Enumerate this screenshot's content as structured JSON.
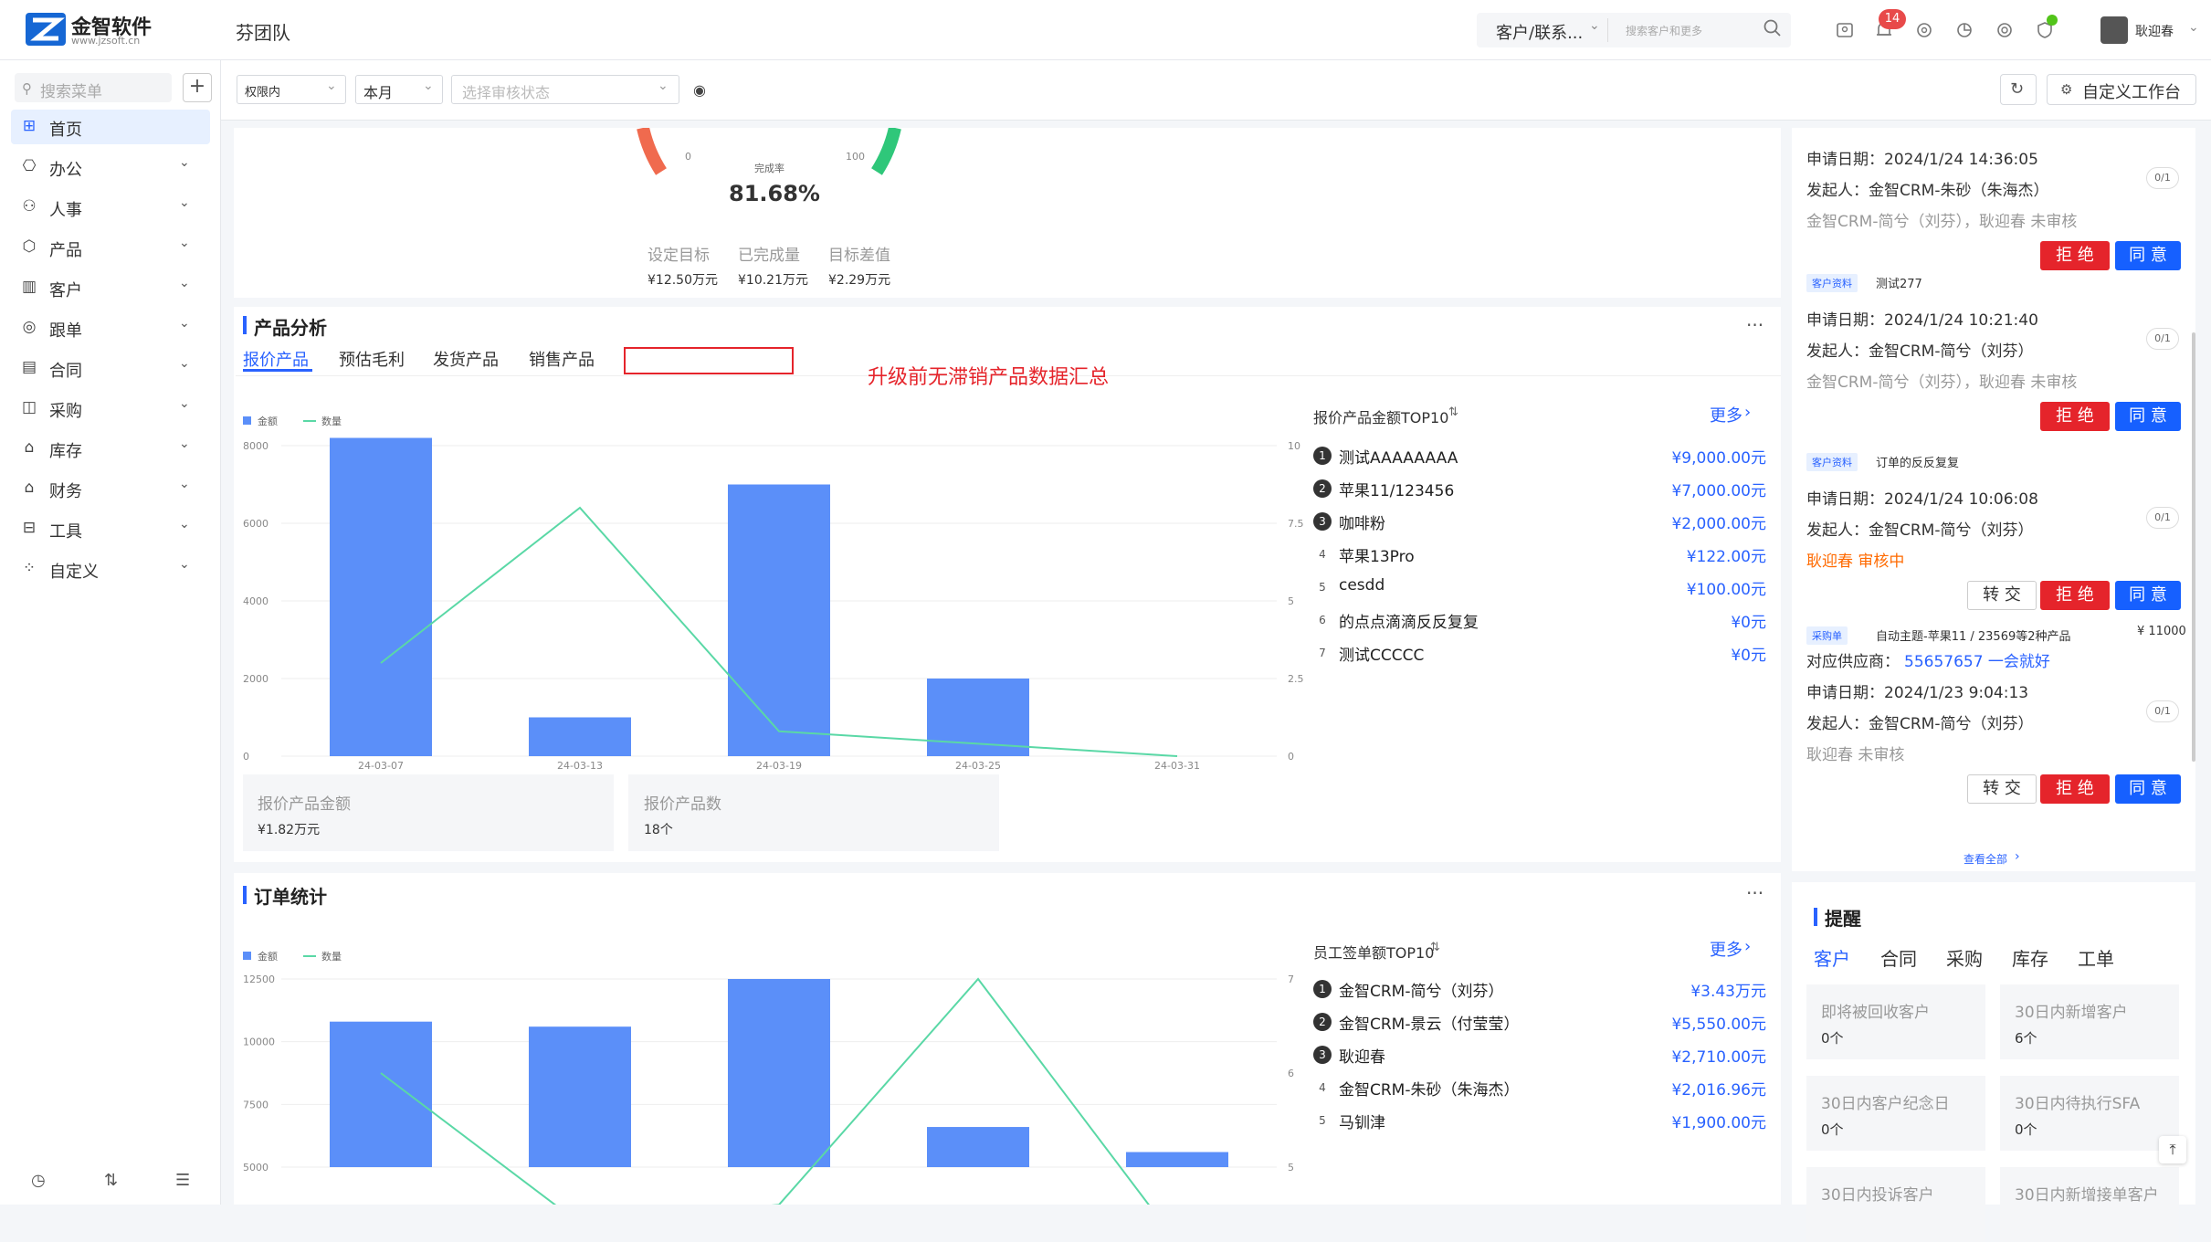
{
  "brand": {
    "name": "金智软件",
    "site": "www.jzsoft.cn"
  },
  "header": {
    "team": "芬团队",
    "search_type": "客户/联系...",
    "search_placeholder": "搜索客户和更多",
    "notification_count": "14",
    "username": "耿迎春"
  },
  "sidebar": {
    "search_placeholder": "搜索菜单",
    "items": [
      {
        "label": "首页",
        "icon": "home-icon"
      },
      {
        "label": "办公",
        "icon": "office-icon"
      },
      {
        "label": "人事",
        "icon": "person-icon"
      },
      {
        "label": "产品",
        "icon": "cube-icon"
      },
      {
        "label": "客户",
        "icon": "chart-icon"
      },
      {
        "label": "跟单",
        "icon": "target-icon"
      },
      {
        "label": "合同",
        "icon": "document-icon"
      },
      {
        "label": "采购",
        "icon": "bag-icon"
      },
      {
        "label": "库存",
        "icon": "warehouse-icon"
      },
      {
        "label": "财务",
        "icon": "money-icon"
      },
      {
        "label": "工具",
        "icon": "toolbox-icon"
      },
      {
        "label": "自定义",
        "icon": "grid-icon"
      }
    ]
  },
  "filters": {
    "scope": "权限内",
    "period": "本月",
    "status_placeholder": "选择审核状态",
    "custom_workbench": "自定义工作台"
  },
  "gauge": {
    "min_label": "0",
    "max_label": "100",
    "caption": "完成率",
    "percent": "81.68%",
    "value": 81.68,
    "stats": [
      {
        "label": "设定目标",
        "value": "¥12.50万元"
      },
      {
        "label": "已完成量",
        "value": "¥10.21万元"
      },
      {
        "label": "目标差值",
        "value": "¥2.29万元"
      }
    ]
  },
  "product_analysis": {
    "title": "产品分析",
    "tabs": [
      "报价产品",
      "预估毛利",
      "发货产品",
      "销售产品"
    ],
    "annotation": "升级前无滞销产品数据汇总",
    "legend": {
      "amount": "金额",
      "count": "数量"
    },
    "stats": [
      {
        "label": "报价产品金额",
        "value": "¥1.82万元"
      },
      {
        "label": "报价产品数",
        "value": "18个"
      }
    ],
    "ranking_title": "报价产品金额TOP10",
    "more": "更多",
    "ranking": [
      {
        "rank": "1",
        "name": "测试AAAAAAAA",
        "value": "¥9,000.00元"
      },
      {
        "rank": "2",
        "name": "苹果11/123456",
        "value": "¥7,000.00元"
      },
      {
        "rank": "3",
        "name": "咖啡粉",
        "value": "¥2,000.00元"
      },
      {
        "rank": "4",
        "name": "苹果13Pro",
        "value": "¥122.00元"
      },
      {
        "rank": "5",
        "name": "cesdd",
        "value": "¥100.00元"
      },
      {
        "rank": "6",
        "name": "的点点滴滴反反复复",
        "value": "¥0元"
      },
      {
        "rank": "7",
        "name": "测试CCCCC",
        "value": "¥0元"
      }
    ]
  },
  "order_stats": {
    "title": "订单统计",
    "legend": {
      "amount": "金额",
      "count": "数量"
    },
    "ranking_title": "员工签单额TOP10",
    "more": "更多",
    "ranking": [
      {
        "rank": "1",
        "name": "金智CRM-简兮（刘芬）",
        "value": "¥3.43万元"
      },
      {
        "rank": "2",
        "name": "金智CRM-景云（付莹莹）",
        "value": "¥5,550.00元"
      },
      {
        "rank": "3",
        "name": "耿迎春",
        "value": "¥2,710.00元"
      },
      {
        "rank": "4",
        "name": "金智CRM-朱砂（朱海杰）",
        "value": "¥2,016.96元"
      },
      {
        "rank": "5",
        "name": "马钏津",
        "value": "¥1,900.00元"
      }
    ]
  },
  "chart_data": [
    {
      "type": "bar",
      "title": "",
      "categories": [
        "24-03-07",
        "24-03-13",
        "24-03-19",
        "24-03-25",
        "24-03-31"
      ],
      "series": [
        {
          "name": "金额",
          "kind": "bar",
          "values": [
            8200,
            1000,
            7000,
            2000,
            0
          ]
        },
        {
          "name": "数量",
          "kind": "line",
          "values": [
            3,
            8,
            0.8,
            0.4,
            0
          ]
        }
      ],
      "ylim": [
        0,
        8000
      ],
      "y2lim": [
        0,
        10
      ],
      "yticks": [
        "0",
        "2000",
        "4000",
        "6000",
        "8000"
      ],
      "y2ticks": [
        "0",
        "2.5",
        "5",
        "7.5",
        "10"
      ],
      "color_bar": "#5b8ff9",
      "color_line": "#5ad8a6"
    },
    {
      "type": "bar",
      "title": "",
      "categories": [
        "",
        "",
        "",
        "",
        ""
      ],
      "series": [
        {
          "name": "金额",
          "kind": "bar",
          "values": [
            10800,
            10600,
            12500,
            6600,
            5600
          ]
        },
        {
          "name": "数量",
          "kind": "line",
          "values": [
            6,
            4.4,
            4.6,
            7,
            4.2
          ]
        }
      ],
      "yticks": [
        "5000",
        "7500",
        "10000",
        "12500"
      ],
      "y2ticks": [
        "5",
        "6",
        "7"
      ],
      "color_bar": "#5b8ff9",
      "color_line": "#5ad8a6"
    }
  ],
  "approvals": [
    {
      "date": "申请日期：2024/1/24 14:36:05",
      "initiator": "发起人：金智CRM-朱砂（朱海杰）",
      "status": "金智CRM-简兮（刘芬），耿迎春 未审核",
      "status_style": "grey",
      "count": "0/1",
      "buttons": [
        "拒 绝",
        "同 意"
      ]
    },
    {
      "tag": "客户资料",
      "title": "测试277",
      "date": "申请日期：2024/1/24 10:21:40",
      "initiator": "发起人：金智CRM-简兮（刘芬）",
      "status": "金智CRM-简兮（刘芬），耿迎春 未审核",
      "status_style": "grey",
      "count": "0/1",
      "buttons": [
        "拒 绝",
        "同 意"
      ]
    },
    {
      "tag": "客户资料",
      "title": "订单的反反复复",
      "date": "申请日期：2024/1/24 10:06:08",
      "initiator": "发起人：金智CRM-简兮（刘芬）",
      "status": "耿迎春 审核中",
      "status_style": "orange",
      "count": "0/1",
      "buttons": [
        "转 交",
        "拒 绝",
        "同 意"
      ]
    },
    {
      "tag": "采购单",
      "title": "自动主题-苹果11 / 23569等2种产品",
      "amount": "¥ 11000",
      "supplier_label": "对应供应商：",
      "supplier": "55657657 一会就好",
      "date": "申请日期：2024/1/23 9:04:13",
      "initiator": "发起人：金智CRM-简兮（刘芬）",
      "status": "耿迎春 未审核",
      "status_style": "grey",
      "count": "0/1",
      "buttons": [
        "转 交",
        "拒 绝",
        "同 意"
      ]
    }
  ],
  "view_all": "查看全部",
  "reminders": {
    "title": "提醒",
    "tabs": [
      "客户",
      "合同",
      "采购",
      "库存",
      "工单"
    ],
    "tiles": [
      {
        "label": "即将被回收客户",
        "value": "0个"
      },
      {
        "label": "30日内新增客户",
        "value": "6个"
      },
      {
        "label": "30日内客户纪念日",
        "value": "0个"
      },
      {
        "label": "30日内待执行SFA",
        "value": "0个"
      },
      {
        "label": "30日内投诉客户",
        "value": ""
      },
      {
        "label": "30日内新增接单客户",
        "value": ""
      }
    ]
  }
}
